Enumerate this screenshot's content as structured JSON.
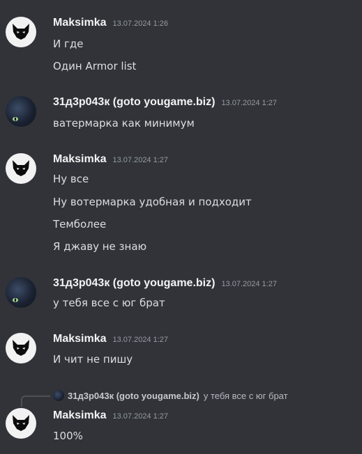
{
  "messages": [
    {
      "author": "Maksimka",
      "avatar": "white-fox-icon",
      "timestamp": "13.07.2024 1:26",
      "lines": [
        "И где",
        "Один Armor list"
      ]
    },
    {
      "author": "31д3р043к (goto yougame.biz)",
      "avatar": "black-cat-icon",
      "timestamp": "13.07.2024 1:27",
      "lines": [
        "ватермарка как минимум"
      ]
    },
    {
      "author": "Maksimka",
      "avatar": "white-fox-icon",
      "timestamp": "13.07.2024 1:27",
      "lines": [
        "Ну все",
        "Ну вотермарка удобная и подходит",
        "Темболее",
        "Я джаву не знаю"
      ]
    },
    {
      "author": "31д3р043к (goto yougame.biz)",
      "avatar": "black-cat-icon",
      "timestamp": "13.07.2024 1:27",
      "lines": [
        "у тебя все с юг брат"
      ]
    },
    {
      "author": "Maksimka",
      "avatar": "white-fox-icon",
      "timestamp": "13.07.2024 1:27",
      "lines": [
        "И чит не пишу"
      ]
    },
    {
      "reply": {
        "author": "31д3р043к (goto yougame.biz)",
        "text": "у тебя все с юг брат"
      },
      "author": "Maksimka",
      "avatar": "white-fox-icon",
      "timestamp": "13.07.2024 1:27",
      "lines": [
        "100%"
      ]
    }
  ]
}
